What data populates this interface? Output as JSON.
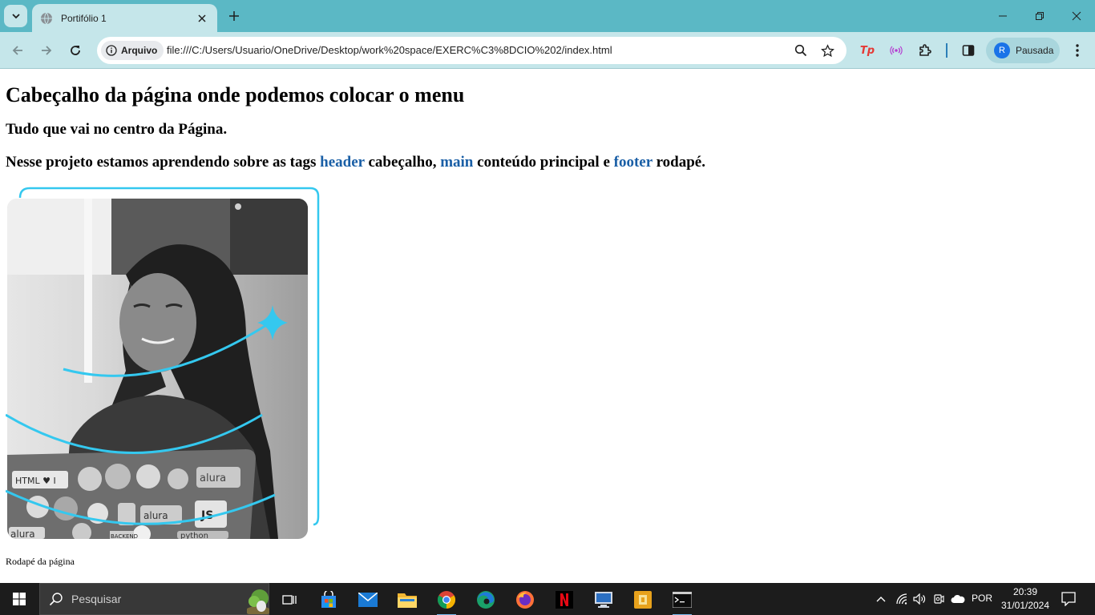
{
  "browser": {
    "tab": {
      "title": "Portifólio 1"
    },
    "address": {
      "security_chip": "Arquivo",
      "url": "file:///C:/Users/Usuario/OneDrive/Desktop/work%20space/EXERC%C3%8DCIO%202/index.html"
    },
    "profile": {
      "initial": "R",
      "label": "Pausada"
    },
    "extensions": {
      "tp_label": "Tp"
    }
  },
  "page": {
    "header_text": "Cabeçalho da página onde podemos colocar o menu",
    "main_subtitle": "Tudo que vai no centro da Página.",
    "paragraph": {
      "p1": "Nesse projeto estamos aprendendo sobre as tags ",
      "kw1": "header",
      "p2": " cabeçalho, ",
      "kw2": "main",
      "p3": " conteúdo principal e ",
      "kw3": "footer",
      "p4": " rodapé."
    },
    "image_sticker_texts": {
      "s1": "HTML ♥ I",
      "s2": "alura",
      "s3": "alura",
      "s4": "JS",
      "s5": "python",
      "s6": "alura",
      "s7": "BACKEND"
    },
    "footer_text": "Rodapé da página"
  },
  "taskbar": {
    "search_placeholder": "Pesquisar",
    "language": "POR",
    "time": "20:39",
    "date": "31/01/2024"
  },
  "colors": {
    "tabstrip": "#5bb8c5",
    "toolbar": "#c5e6ea",
    "link_keyword": "#1a5fa6",
    "photo_accent": "#34c8ef"
  }
}
